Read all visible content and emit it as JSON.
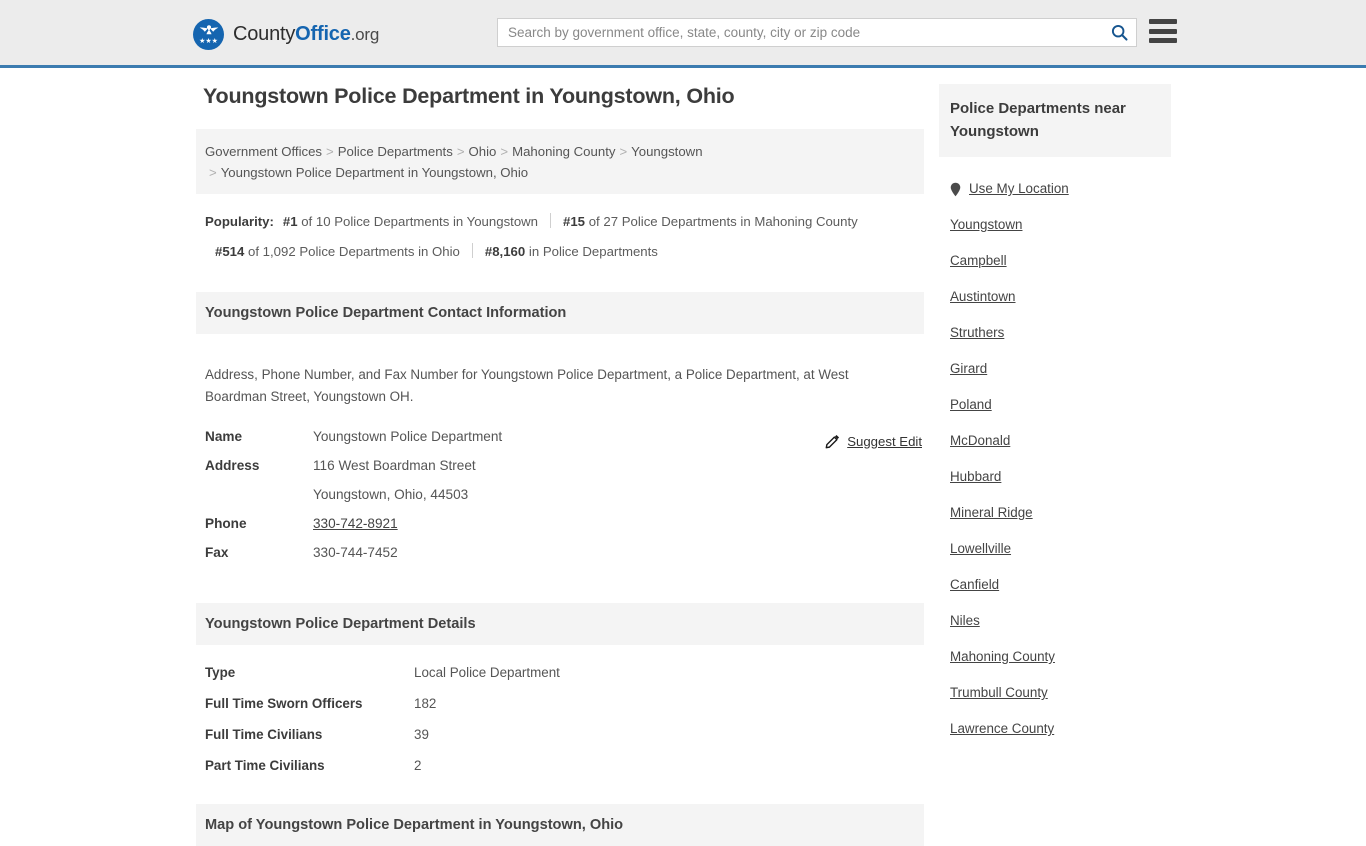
{
  "header": {
    "brand": {
      "part1": "County",
      "part2": "Office",
      "part3": ".org",
      "logo_icon": "eagle-seal-icon",
      "stars": "★★★"
    },
    "search": {
      "placeholder": "Search by government office, state, county, city or zip code",
      "value": "",
      "icon": "search-icon"
    },
    "menu_icon": "hamburger-menu-icon",
    "accent_color": "#3c7cb0"
  },
  "page_title": "Youngstown Police Department in Youngstown, Ohio",
  "breadcrumb": {
    "separator": ">",
    "items": [
      "Government Offices",
      "Police Departments",
      "Ohio",
      "Mahoning County",
      "Youngstown"
    ],
    "current": "Youngstown Police Department in Youngstown, Ohio"
  },
  "popularity": {
    "label": "Popularity:",
    "items": [
      {
        "rank": "#1",
        "text": "of 10 Police Departments in Youngstown"
      },
      {
        "rank": "#15",
        "text": "of 27 Police Departments in Mahoning County"
      },
      {
        "rank": "#514",
        "text": "of 1,092 Police Departments in Ohio"
      },
      {
        "rank": "#8,160",
        "text": "in Police Departments"
      }
    ]
  },
  "contact": {
    "heading": "Youngstown Police Department Contact Information",
    "description": "Address, Phone Number, and Fax Number for Youngstown Police Department, a Police Department, at West Boardman Street, Youngstown OH.",
    "suggest_edit": {
      "label": "Suggest Edit",
      "icon": "pencil-edit-icon"
    },
    "rows": [
      {
        "key": "Name",
        "value": "Youngstown Police Department",
        "link": false
      },
      {
        "key": "Address",
        "value": "116 West Boardman Street",
        "link": false
      },
      {
        "key": "",
        "value": "Youngstown, Ohio, 44503",
        "link": false
      },
      {
        "key": "Phone",
        "value": "330-742-8921",
        "link": true
      },
      {
        "key": "Fax",
        "value": "330-744-7452",
        "link": false
      }
    ]
  },
  "details": {
    "heading": "Youngstown Police Department Details",
    "rows": [
      {
        "key": "Type",
        "value": "Local Police Department"
      },
      {
        "key": "Full Time Sworn Officers",
        "value": "182"
      },
      {
        "key": "Full Time Civilians",
        "value": "39"
      },
      {
        "key": "Part Time Civilians",
        "value": "2"
      }
    ]
  },
  "map": {
    "heading": "Map of Youngstown Police Department in Youngstown, Ohio"
  },
  "sidebar": {
    "heading": "Police Departments near Youngstown",
    "use_my_location": {
      "label": "Use My Location",
      "icon": "map-pin-icon"
    },
    "links": [
      "Youngstown",
      "Campbell",
      "Austintown",
      "Struthers",
      "Girard",
      "Poland",
      "McDonald",
      "Hubbard",
      "Mineral Ridge",
      "Lowellville",
      "Canfield",
      "Niles",
      "Mahoning County",
      "Trumbull County",
      "Lawrence County"
    ]
  }
}
